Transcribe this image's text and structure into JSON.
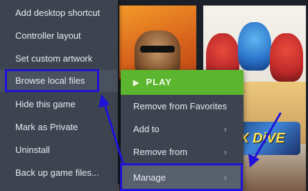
{
  "context_menu": {
    "items": [
      {
        "label": "Add desktop shortcut"
      },
      {
        "label": "Controller layout"
      },
      {
        "label": "Set custom artwork"
      },
      {
        "label": "Browse local files"
      },
      {
        "label": "Hide this game"
      },
      {
        "label": "Mark as Private"
      },
      {
        "label": "Uninstall"
      },
      {
        "label": "Back up game files..."
      }
    ]
  },
  "game_menu": {
    "play_label": "PLAY",
    "items": [
      {
        "label": "Remove from Favorites"
      },
      {
        "label": "Add to"
      },
      {
        "label": "Remove from"
      },
      {
        "label": "Manage"
      }
    ]
  },
  "tiles": {
    "right_logo_text": "X DiVE"
  },
  "colors": {
    "menu_bg": "#3d4450",
    "play_green": "#5cb52e",
    "highlight_blue": "#1f12d8"
  }
}
